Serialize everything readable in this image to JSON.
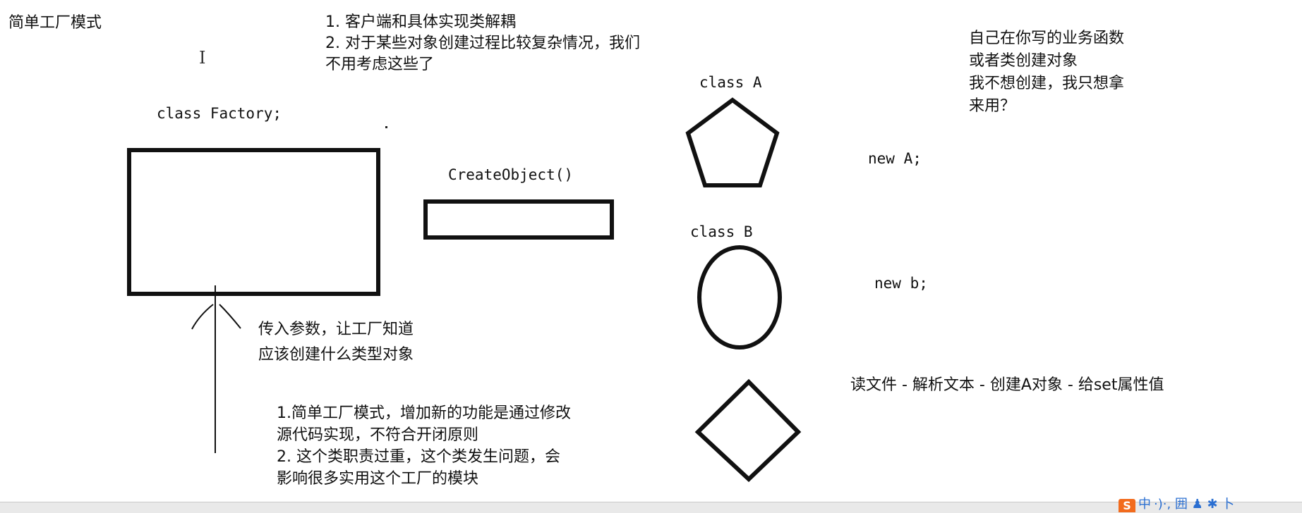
{
  "title": "简单工厂模式",
  "benefits": {
    "line1": "1. 客户端和具体实现类解耦",
    "line2": "2. 对于某些对象创建过程比较复杂情况，我们",
    "line3": "不用考虑这些了"
  },
  "motivation": {
    "line1": "自己在你写的业务函数",
    "line2": "或者类创建对象",
    "line3": "我不想创建，我只想拿",
    "line4": "来用？"
  },
  "factory": {
    "label": "class Factory;",
    "method_label": "CreateObject()"
  },
  "class_a": {
    "label": "class A",
    "instantiation": "new A;"
  },
  "class_b": {
    "label": "class B",
    "instantiation": "new b;"
  },
  "param_note": {
    "line1": "传入参数，让工厂知道",
    "line2": "应该创建什么类型对象"
  },
  "drawbacks": {
    "line1": "1.简单工厂模式，增加新的功能是通过修改",
    "line2": "源代码实现，不符合开闭原则",
    "line3": "2. 这个类职责过重，这个类发生问题，会",
    "line4": "影响很多实用这个工厂的模块"
  },
  "process_note": "读文件 - 解析文本 - 创建A对象 - 给set属性值",
  "cursor_glyph": "I",
  "taskbar": {
    "ime_logo": "S",
    "ime_mode": "中",
    "ime_icons": "·)·, 囲 ♟ ✱ 卜"
  },
  "colors": {
    "ink": "#111111",
    "background": "#ffffff",
    "ime_orange": "#f26b1d",
    "ime_blue": "#2b6fd1"
  }
}
